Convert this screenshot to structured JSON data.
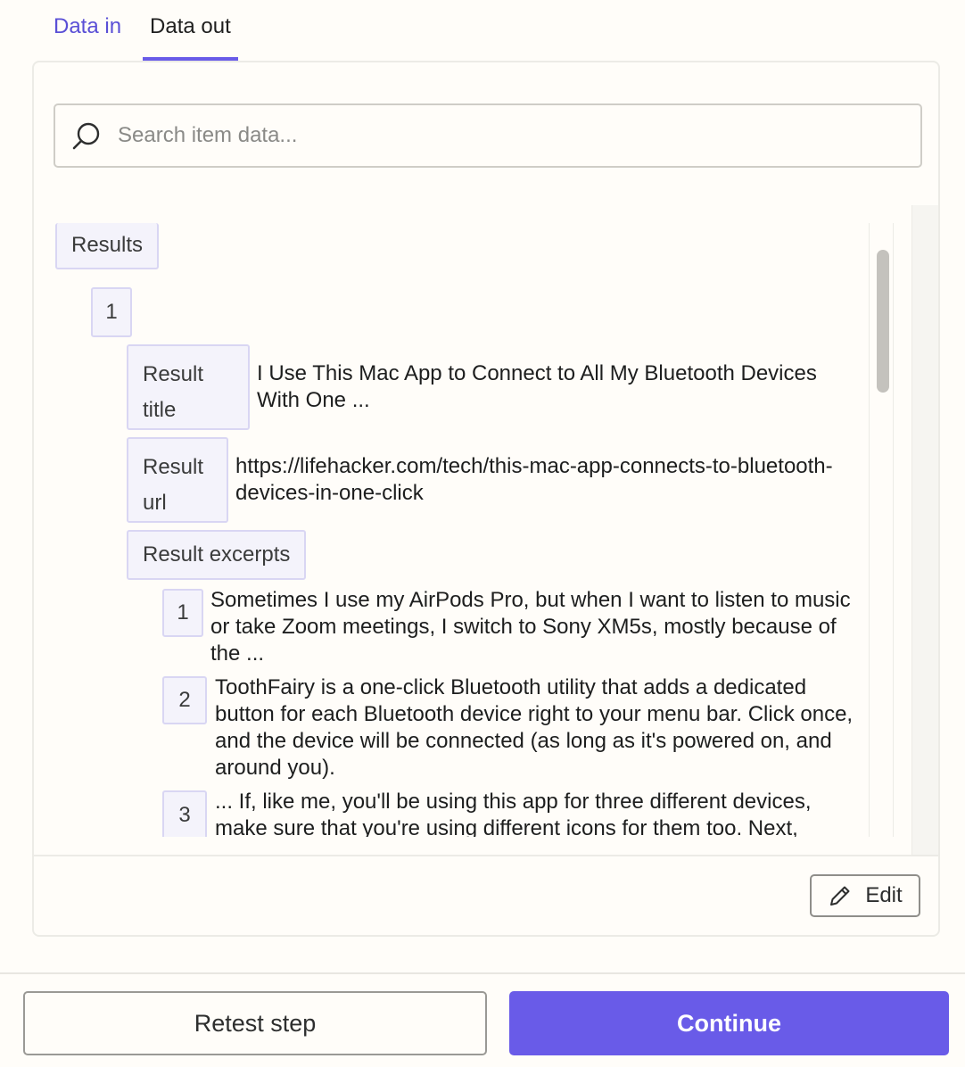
{
  "tabs": [
    {
      "label": "Data in"
    },
    {
      "label": "Data out"
    }
  ],
  "search": {
    "placeholder": "Search item data..."
  },
  "tree": {
    "results_label": "Results",
    "item_index": "1",
    "result_title_key": "Result title",
    "result_title_value": "I Use This Mac App to Connect to All My Bluetooth Devices With One ...",
    "result_url_key": "Result url",
    "result_url_value": "https://lifehacker.com/tech/this-mac-app-connects-to-bluetooth-devices-in-one-click",
    "excerpts_key": "Result excerpts",
    "excerpts": [
      {
        "index": "1",
        "text": "Sometimes I use my AirPods Pro, but when I want to listen to music or take Zoom meetings, I switch to Sony XM5s, mostly because of the ..."
      },
      {
        "index": "2",
        "text": "ToothFairy is a one-click Bluetooth utility that adds a dedicated button for each Bluetooth device right to your menu bar. Click once, and the device will be connected (as long as it's powered on, and around you)."
      },
      {
        "index": "3",
        "text": "... If, like me, you'll be using this app for three different devices, make sure that you're using different icons for them too. Next,"
      }
    ]
  },
  "edit_label": "Edit",
  "footer": {
    "retest_label": "Retest step",
    "continue_label": "Continue"
  },
  "colors": {
    "accent": "#695be8",
    "key_border": "#d9d6f3",
    "key_bg": "#f4f3fb"
  },
  "icons": [
    "search-icon",
    "pencil-icon"
  ]
}
